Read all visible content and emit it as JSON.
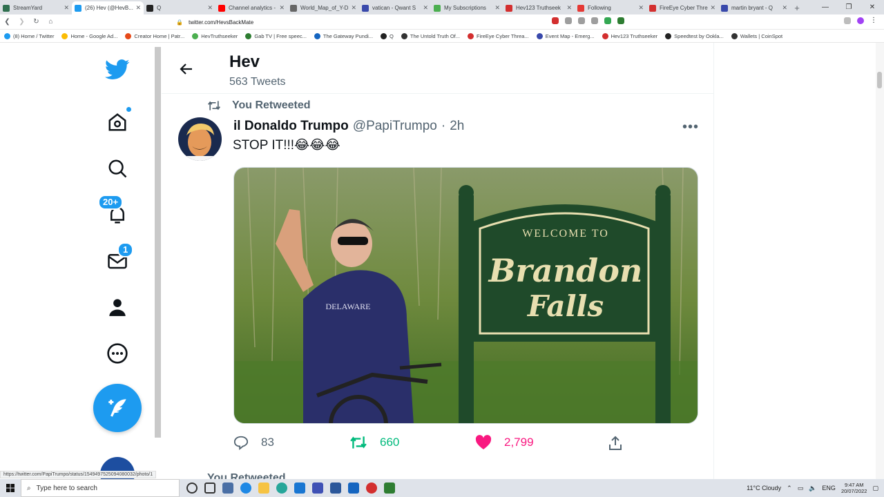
{
  "browser": {
    "tabs": [
      {
        "label": "StreamYard",
        "color": "#2f6f4f"
      },
      {
        "label": "(26) Hev (@HevB...",
        "color": "#1d9bf0"
      },
      {
        "label": "Q",
        "color": "#222222"
      },
      {
        "label": "Channel analytics -",
        "color": "#ff0000"
      },
      {
        "label": "World_Map_of_Y-D",
        "color": "#666666"
      },
      {
        "label": "vatican - Qwant S",
        "color": "#3949ab"
      },
      {
        "label": "My Subscriptions",
        "color": "#4caf50"
      },
      {
        "label": "Hev123 Truthseek",
        "color": "#d32f2f"
      },
      {
        "label": "Following",
        "color": "#e53935"
      },
      {
        "label": "FireEye Cyber Thre",
        "color": "#d32f2f"
      },
      {
        "label": "martin bryant - Q",
        "color": "#3949ab"
      }
    ],
    "url": "twitter.com/HevsBackMate",
    "bookmarks": [
      {
        "label": "(8) Home / Twitter",
        "color": "#1d9bf0"
      },
      {
        "label": "Home - Google Ad...",
        "color": "#fbbc04"
      },
      {
        "label": "Creator Home | Patr...",
        "color": "#e64a19"
      },
      {
        "label": "HevTruthseeker",
        "color": "#4caf50"
      },
      {
        "label": "Gab TV | Free speec...",
        "color": "#2e7d32"
      },
      {
        "label": "The Gateway Pundi...",
        "color": "#1565c0"
      },
      {
        "label": "Q",
        "color": "#222222"
      },
      {
        "label": "The Untold Truth Of...",
        "color": "#333333"
      },
      {
        "label": "FireEye Cyber Threa...",
        "color": "#d32f2f"
      },
      {
        "label": "Event Map - Emerg...",
        "color": "#3949ab"
      },
      {
        "label": "Hev123 Truthseeker",
        "color": "#d32f2f"
      },
      {
        "label": "Speedtest by Ookla...",
        "color": "#222222"
      },
      {
        "label": "Wallets | CoinSpot",
        "color": "#333333"
      }
    ]
  },
  "sidebar": {
    "notifications_badge": "20+",
    "messages_badge": "1"
  },
  "header": {
    "name": "Hev",
    "tweet_count": "563 Tweets"
  },
  "tweet": {
    "retweet_label": "You Retweeted",
    "author_name": "il Donaldo Trumpo",
    "handle": "@PapiTrumpo",
    "separator": "·",
    "time": "2h",
    "text": "STOP IT!!!😂😂😂",
    "sign_text_top": "WELCOME TO",
    "sign_text_main": "Brandon",
    "sign_text_sub": "Falls",
    "shirt_text": "DELAWARE",
    "replies": "83",
    "retweets": "660",
    "likes": "2,799"
  },
  "next_item_label": "You Retweeted",
  "status_url": "https://twitter.com/PapiTrumpo/status/1549497525094080032/photo/1",
  "colors": {
    "twitter_blue": "#1d9bf0",
    "retweet_green": "#00ba7c",
    "like_pink": "#f91880"
  },
  "taskbar": {
    "search_placeholder": "Type here to search",
    "weather": "11°C  Cloudy",
    "language": "ENG",
    "time": "9:47 AM",
    "date": "20/07/2022"
  }
}
